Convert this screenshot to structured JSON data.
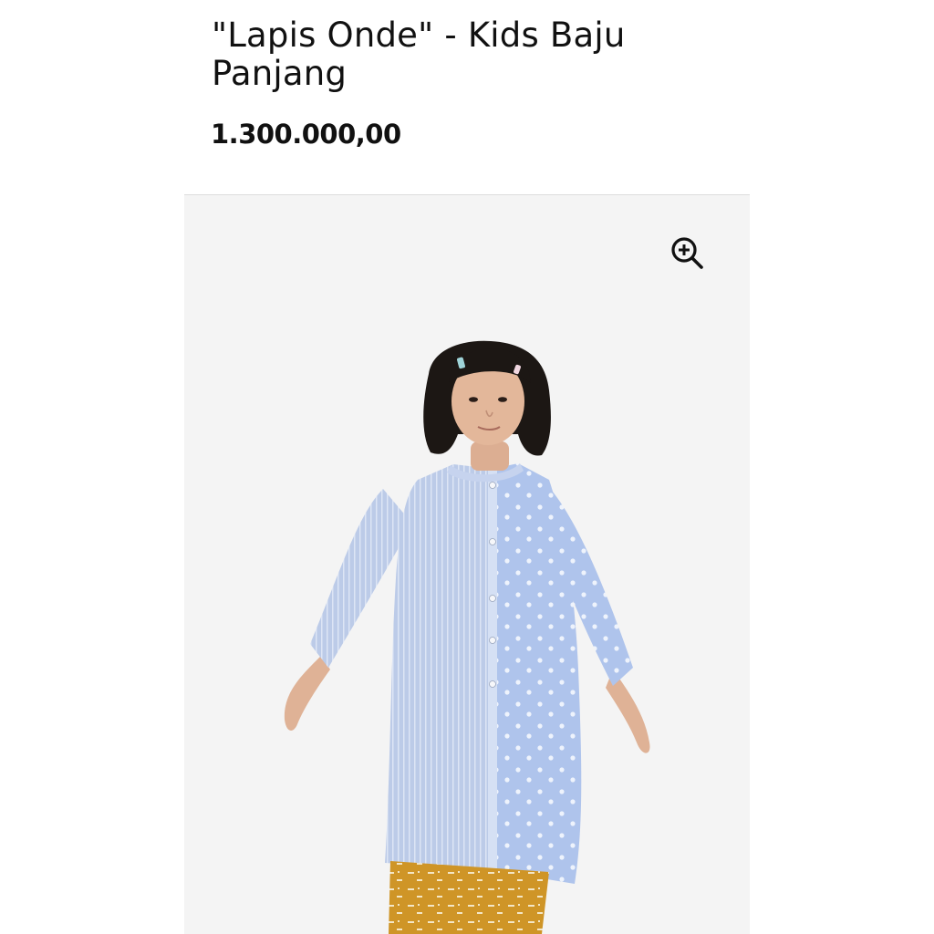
{
  "product": {
    "title": "\"Lapis Onde\" - Kids Baju Panjang",
    "price": "1.300.000,00"
  },
  "gallery": {
    "zoom_icon": "zoom-in-icon",
    "image_subject": "product-photo",
    "colors": {
      "background": "#f4f4f4",
      "shirt_blue": "#b7c9ea",
      "pants_mustard": "#d19a2a",
      "hair": "#1c1714",
      "skin": "#e3b79a"
    }
  }
}
